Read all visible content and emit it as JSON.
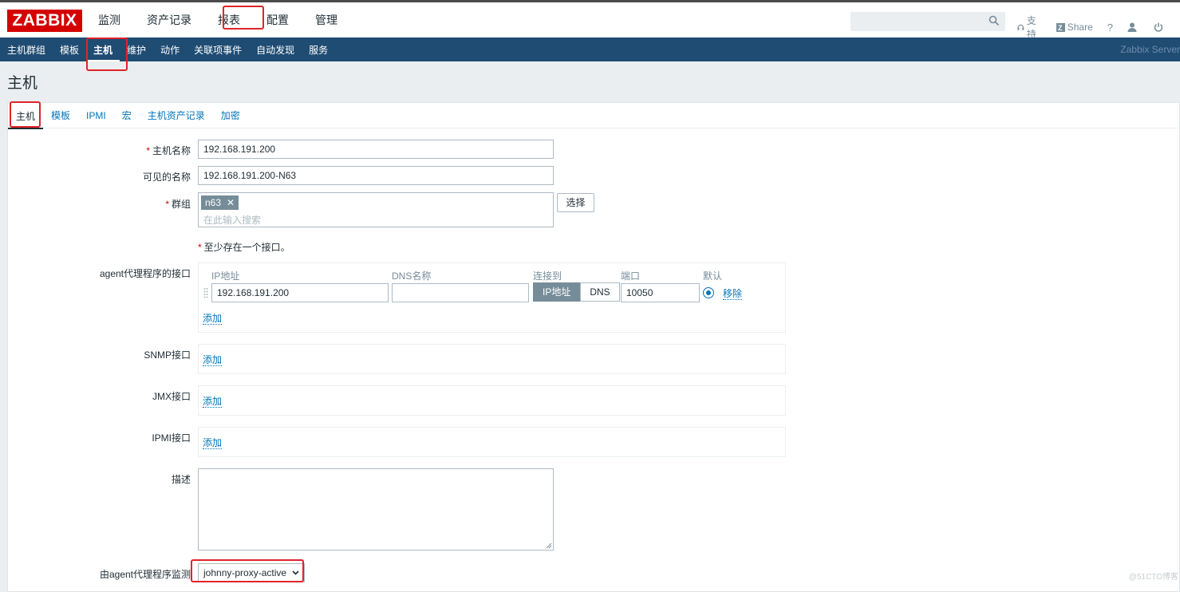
{
  "app": {
    "logo": "ZABBIX",
    "server_name": "Zabbix Server"
  },
  "top_menu": [
    "监测",
    "资产记录",
    "报表",
    "配置",
    "管理"
  ],
  "top_links": {
    "support": "支持",
    "share": "Share",
    "help": "?"
  },
  "sub_menu": [
    "主机群组",
    "模板",
    "主机",
    "维护",
    "动作",
    "关联项事件",
    "自动发现",
    "服务"
  ],
  "page": {
    "title": "主机"
  },
  "tabs": [
    "主机",
    "模板",
    "IPMI",
    "宏",
    "主机资产记录",
    "加密"
  ],
  "form": {
    "host_name_label": "主机名称",
    "host_name_value": "192.168.191.200",
    "visible_name_label": "可见的名称",
    "visible_name_value": "192.168.191.200-N63",
    "groups_label": "群组",
    "group_chip": "n63",
    "groups_placeholder": "在此输入搜索",
    "select_button": "选择",
    "interface_note": "至少存在一个接口。",
    "agent_iface_label": "agent代理程序的接口",
    "col_ip": "IP地址",
    "col_dns": "DNS名称",
    "col_connect": "连接到",
    "col_port": "端口",
    "col_default": "默认",
    "ip_value": "192.168.191.200",
    "dns_value": "",
    "connect_ip": "IP地址",
    "connect_dns": "DNS",
    "port_value": "10050",
    "remove_link": "移除",
    "add_link": "添加",
    "snmp_label": "SNMP接口",
    "jmx_label": "JMX接口",
    "ipmi_label": "IPMI接口",
    "desc_label": "描述",
    "proxy_label": "由agent代理程序监测",
    "proxy_value": "johnny-proxy-active"
  },
  "colors": {
    "brand": "#d40000",
    "nav": "#1f4c73",
    "link": "#0275b8",
    "highlight": "#e0242a"
  },
  "watermark": "@51CTO博客"
}
